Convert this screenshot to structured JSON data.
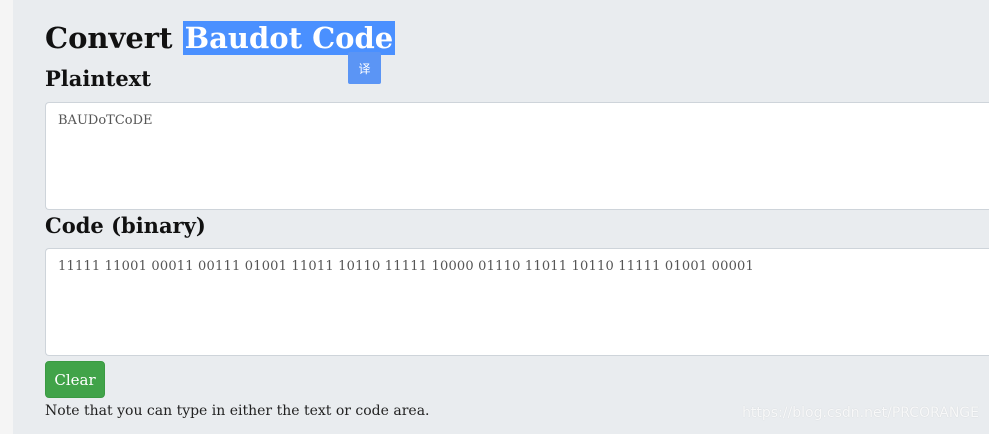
{
  "page": {
    "title_prefix": "Convert",
    "title_highlight": "Baudot Code"
  },
  "translate_button": {
    "label": "译"
  },
  "plaintext": {
    "label": "Plaintext",
    "value": "BAUDoTCoDE"
  },
  "code": {
    "label": "Code (binary)",
    "value": "11111 11001 00011 00111 01001 11011 10110 11111 10000 01110 11011 10110 11111 01001 00001"
  },
  "actions": {
    "clear_label": "Clear"
  },
  "note": "Note that you can type in either the text or code area.",
  "watermark": "https://blog.csdn.net/PRCORANGE",
  "colors": {
    "highlight": "#4a90ff",
    "translate_button": "#5b95f5",
    "clear_button": "#41a349",
    "background": "#e9ecef"
  }
}
